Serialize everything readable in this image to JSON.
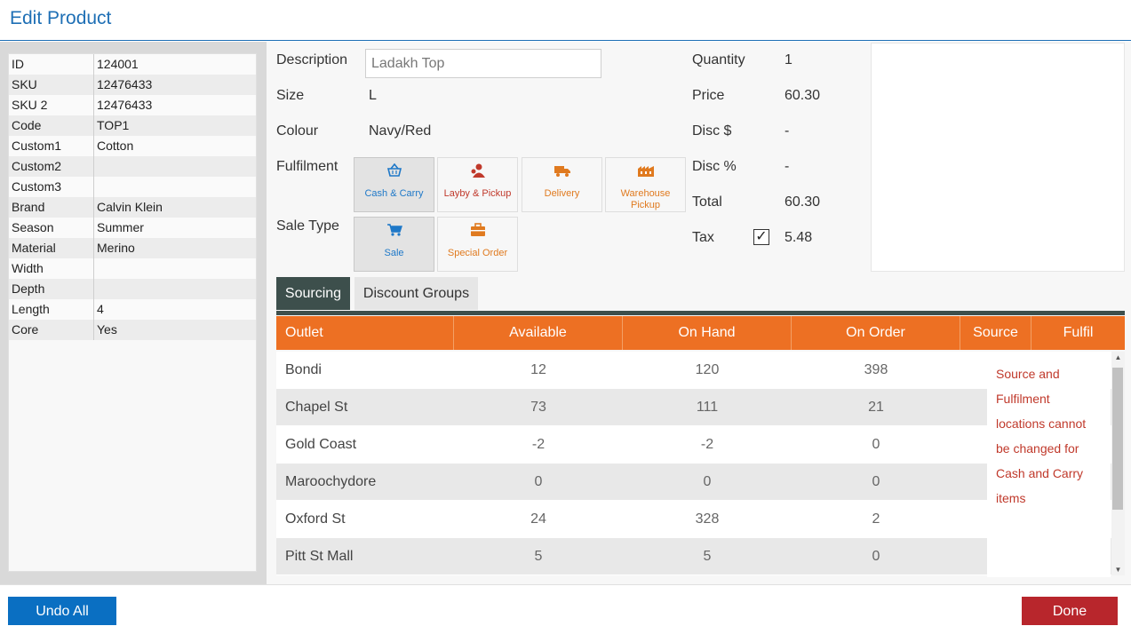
{
  "window": {
    "title": "Edit Product"
  },
  "attributes": [
    {
      "key": "ID",
      "value": "124001"
    },
    {
      "key": "SKU",
      "value": "12476433"
    },
    {
      "key": "SKU 2",
      "value": "12476433"
    },
    {
      "key": "Code",
      "value": "TOP1"
    },
    {
      "key": "Custom1",
      "value": "Cotton"
    },
    {
      "key": "Custom2",
      "value": ""
    },
    {
      "key": "Custom3",
      "value": ""
    },
    {
      "key": "Brand",
      "value": "Calvin Klein"
    },
    {
      "key": "Season",
      "value": "Summer"
    },
    {
      "key": "Material",
      "value": "Merino"
    },
    {
      "key": "Width",
      "value": ""
    },
    {
      "key": "Depth",
      "value": ""
    },
    {
      "key": "Length",
      "value": "4"
    },
    {
      "key": "Core",
      "value": "Yes"
    }
  ],
  "form": {
    "description_label": "Description",
    "description_value": "Ladakh Top",
    "size_label": "Size",
    "size_value": "L",
    "colour_label": "Colour",
    "colour_value": "Navy/Red",
    "fulfilment_label": "Fulfilment",
    "fulfilment_options": [
      {
        "label": "Cash & Carry",
        "icon": "basket-icon",
        "color": "#1e78c8",
        "selected": true
      },
      {
        "label": "Layby & Pickup",
        "icon": "person-icon",
        "color": "#c0392b",
        "selected": false
      },
      {
        "label": "Delivery",
        "icon": "truck-icon",
        "color": "#e07a1f",
        "selected": false
      },
      {
        "label": "Warehouse Pickup",
        "icon": "warehouse-icon",
        "color": "#e07a1f",
        "selected": false
      }
    ],
    "sale_type_label": "Sale Type",
    "sale_type_options": [
      {
        "label": "Sale",
        "icon": "cart-icon",
        "color": "#1e78c8",
        "selected": true
      },
      {
        "label": "Special Order",
        "icon": "briefcase-icon",
        "color": "#e07a1f",
        "selected": false
      }
    ]
  },
  "pricing": {
    "quantity_label": "Quantity",
    "quantity_value": "1",
    "price_label": "Price",
    "price_value": "60.30",
    "disc_amount_label": "Disc $",
    "disc_amount_value": "-",
    "disc_percent_label": "Disc %",
    "disc_percent_value": "-",
    "total_label": "Total",
    "total_value": "60.30",
    "tax_label": "Tax",
    "tax_value": "5.48",
    "tax_checked": true,
    "tax_check_glyph": "✓"
  },
  "tabs": [
    {
      "label": "Sourcing",
      "active": true
    },
    {
      "label": "Discount Groups",
      "active": false
    }
  ],
  "grid": {
    "columns": [
      "Outlet",
      "Available",
      "On Hand",
      "On Order",
      "Source",
      "Fulfil"
    ],
    "rows": [
      {
        "outlet": "Bondi",
        "available": "12",
        "on_hand": "120",
        "on_order": "398"
      },
      {
        "outlet": "Chapel St",
        "available": "73",
        "on_hand": "111",
        "on_order": "21"
      },
      {
        "outlet": "Gold Coast",
        "available": "-2",
        "on_hand": "-2",
        "on_order": "0"
      },
      {
        "outlet": "Maroochydore",
        "available": "0",
        "on_hand": "0",
        "on_order": "0"
      },
      {
        "outlet": "Oxford St",
        "available": "24",
        "on_hand": "328",
        "on_order": "2"
      },
      {
        "outlet": "Pitt St Mall",
        "available": "5",
        "on_hand": "5",
        "on_order": "0"
      }
    ]
  },
  "tooltip": {
    "text": "Source and Fulfilment locations cannot be changed for Cash and Carry items"
  },
  "footer": {
    "undo_label": "Undo All",
    "done_label": "Done"
  },
  "colors": {
    "accent": "#1e6fb5",
    "header_orange": "#ed7023",
    "tab_dark": "#3d4f4c",
    "done_red": "#b8262c",
    "undo_blue": "#0a6fc2"
  }
}
